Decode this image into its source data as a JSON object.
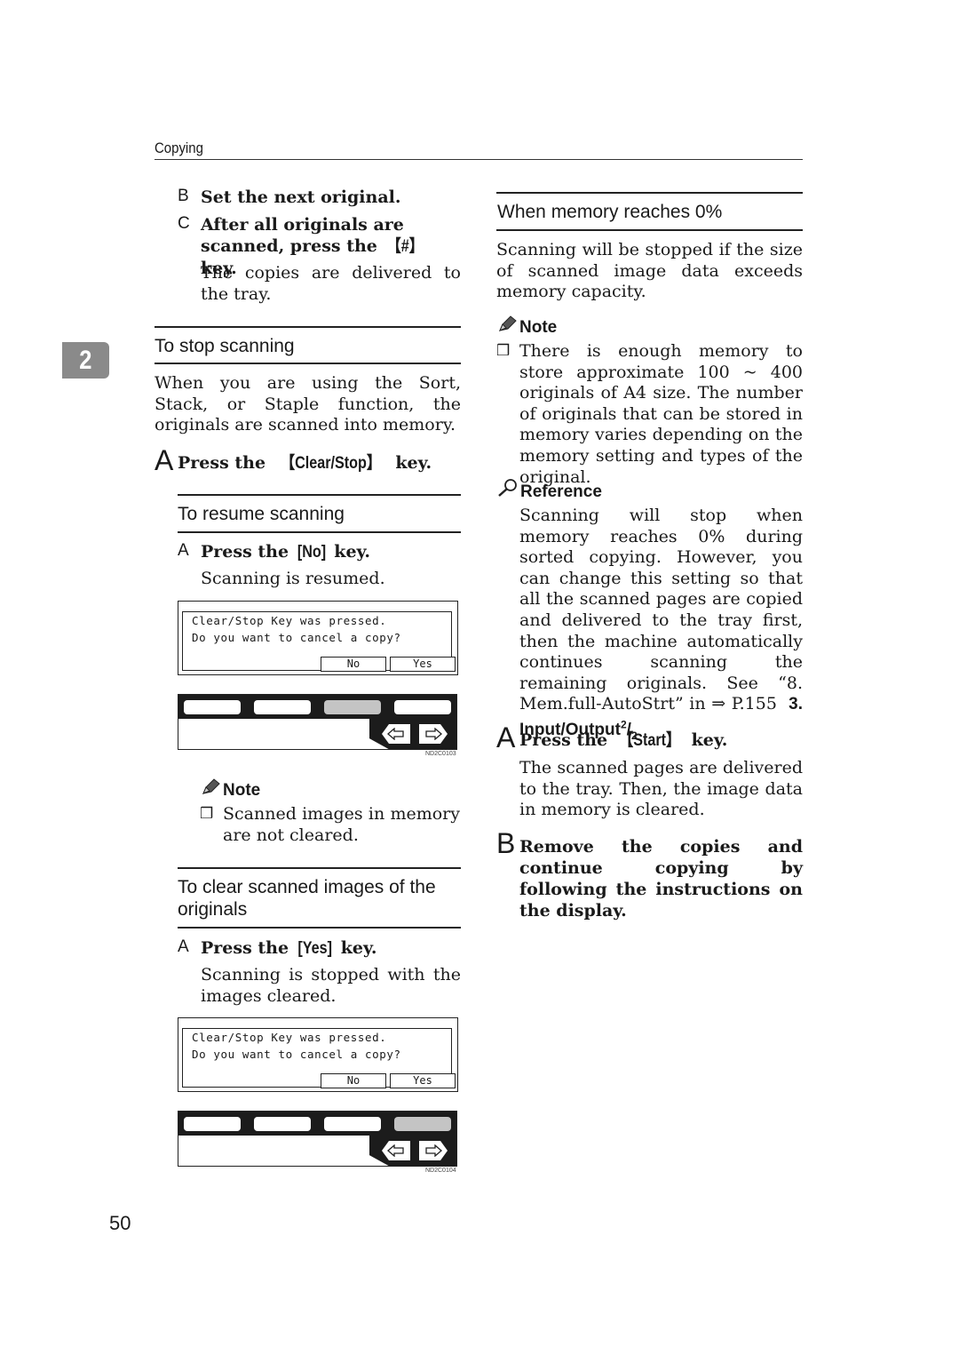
{
  "header": {
    "running_head": "Copying"
  },
  "chapter_tab": "2",
  "page_number": "50",
  "left_column": {
    "steps_top": [
      {
        "letter": "B",
        "text": "Set the next original."
      },
      {
        "letter": "C",
        "text_before": "After all originals are scanned, press the ",
        "key": "【#】",
        "text_after": " key.",
        "description": "The copies are delivered to the tray."
      }
    ],
    "stop_section": {
      "title": "To stop scanning",
      "body": "When you are using the Sort, Stack, or Staple function, the originals are scanned into memory.",
      "step": {
        "letter": "A",
        "text_before": "Press the ",
        "key": "【Clear/Stop】",
        "text_after": " key."
      }
    },
    "resume_section": {
      "title": "To resume scanning",
      "step": {
        "letter": "A",
        "text_before": "Press the ",
        "key": "[No]",
        "text_after": " key.",
        "description": "Scanning is resumed."
      },
      "display": {
        "line1": "Clear/Stop Key was pressed.",
        "line2": "Do you want to cancel a copy?",
        "btn_no": "No",
        "btn_yes": "Yes"
      },
      "panel": {
        "active_key_index": 2,
        "figure_id": "ND2C0103"
      },
      "note": {
        "title": "Note",
        "items": [
          "Scanned images in memory are not cleared."
        ]
      }
    },
    "clear_section": {
      "title": "To clear scanned images of the originals",
      "step": {
        "letter": "A",
        "text_before": "Press the ",
        "key": "[Yes]",
        "text_after": " key.",
        "description": "Scanning is stopped with the images cleared."
      },
      "display": {
        "line1": "Clear/Stop Key was pressed.",
        "line2": "Do you want to cancel a copy?",
        "btn_no": "No",
        "btn_yes": "Yes"
      },
      "panel": {
        "active_key_index": 3,
        "figure_id": "ND2C0104"
      }
    }
  },
  "right_column": {
    "memory_section": {
      "title": "When memory reaches 0%",
      "body": "Scanning will be stopped if the size of scanned image data exceeds memory capacity."
    },
    "note": {
      "title": "Note",
      "items": [
        "There is enough memory to store approximate 100 ~ 400 originals of A4 size. The number of originals that can be stored in memory varies depending on the memory setting and types of the original."
      ]
    },
    "reference": {
      "title": "Reference",
      "body": "Scanning will stop when memory reaches 0% during sorted copying. However, you can change this setting so that all the scanned pages are copied and delivered to the tray first, then the machine automatically continues scanning the remaining originals. See “8. Mem.full-AutoStrt” in ⇒ P.155",
      "link_bold": "3. Input/Output",
      "link_sup": "2",
      "link_sub": "2",
      "link_end": " ."
    },
    "steps": [
      {
        "letter": "A",
        "text_before": "Press the ",
        "key": "【Start】",
        "text_after": " key.",
        "description": "The scanned pages are delivered to the tray. Then, the image data in memory is cleared."
      },
      {
        "letter": "B",
        "text": "Remove the copies and continue copying by following the instructions on the display."
      }
    ]
  }
}
